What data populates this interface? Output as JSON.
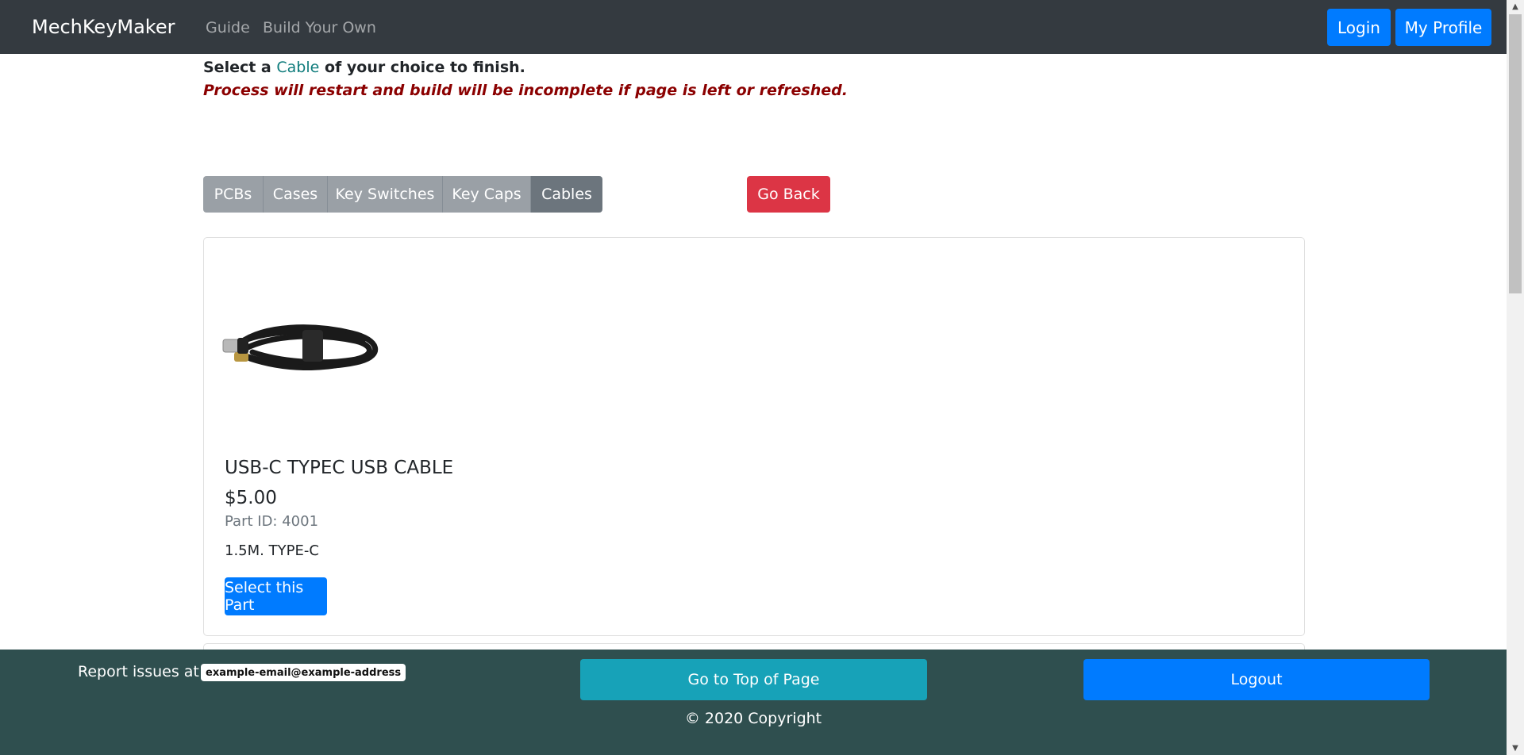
{
  "navbar": {
    "brand": "MechKeyMaker",
    "links": [
      "Guide",
      "Build Your Own"
    ],
    "login_label": "Login",
    "profile_label": "My Profile"
  },
  "instruction": {
    "prefix": "Select a ",
    "highlight": "Cable",
    "suffix": " of your choice to finish.",
    "warning": "Process will restart and build will be incomplete if page is left or refreshed."
  },
  "tabs": [
    "PCBs",
    "Cases",
    "Key Switches",
    "Key Caps",
    "Cables"
  ],
  "active_tab": "Cables",
  "go_back_label": "Go Back",
  "product": {
    "name": "USB-C TYPEC USB CABLE",
    "price": "$5.00",
    "part_id": "Part ID: 4001",
    "description": "1.5M. TYPE-C",
    "select_label": "Select this Part",
    "image_icon": "usb-cable-image"
  },
  "footer": {
    "report_text": "Report issues at",
    "email": "example-email@example-address",
    "top_label": "Go to Top of Page",
    "logout_label": "Logout",
    "copyright": "© 2020 Copyright"
  },
  "colors": {
    "navbar": "#343a40",
    "primary": "#007bff",
    "danger": "#dc3545",
    "info": "#17a2b8",
    "footer": "#2f4f4f",
    "warning_text": "#8b0000",
    "highlight_text": "#0f7c7c"
  }
}
